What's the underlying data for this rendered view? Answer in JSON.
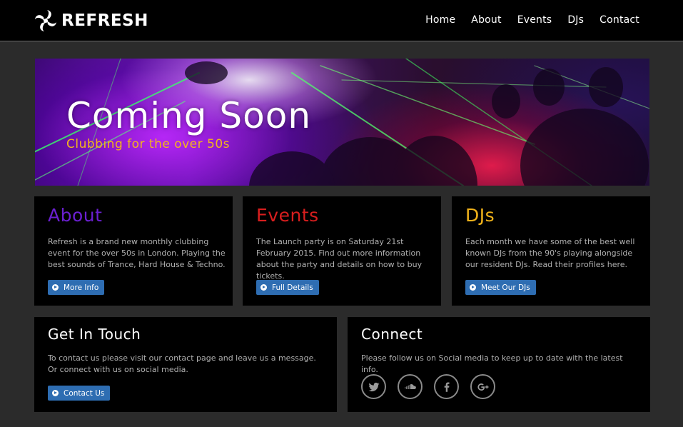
{
  "brand": {
    "name": "REFRESH"
  },
  "nav": {
    "items": [
      {
        "label": "Home"
      },
      {
        "label": "About"
      },
      {
        "label": "Events"
      },
      {
        "label": "DJs"
      },
      {
        "label": "Contact"
      }
    ]
  },
  "hero": {
    "title": "Coming Soon",
    "subtitle": "Clubbing for the over 50s"
  },
  "about": {
    "heading": "About",
    "text": "Refresh is a brand new monthly clubbing event for the over 50s in London. Playing the best sounds of Trance, Hard House & Techno.",
    "button": "More Info"
  },
  "events": {
    "heading": "Events",
    "text": "The Launch party is on Saturday 21st February 2015. Find out more information about the party and details on how to buy tickets.",
    "button": "Full Details"
  },
  "djs": {
    "heading": "DJs",
    "text": "Each month we have some of the best well known DJs from the 90's playing alongside our resident DJs. Read their profiles here.",
    "button": "Meet Our DJs"
  },
  "contact": {
    "heading": "Get In Touch",
    "text": "To contact us please visit our contact page and leave us a message. Or connect with us on social media.",
    "button": "Contact Us"
  },
  "connect": {
    "heading": "Connect",
    "text": "Please follow us on Social media to keep up to date with the latest info.",
    "icons": [
      "twitter-icon",
      "soundcloud-icon",
      "facebook-icon",
      "google-plus-icon"
    ]
  },
  "colors": {
    "about": "#6a1fd0",
    "events": "#d81e1e",
    "djs": "#f0b21a",
    "button": "#2e6db2"
  }
}
